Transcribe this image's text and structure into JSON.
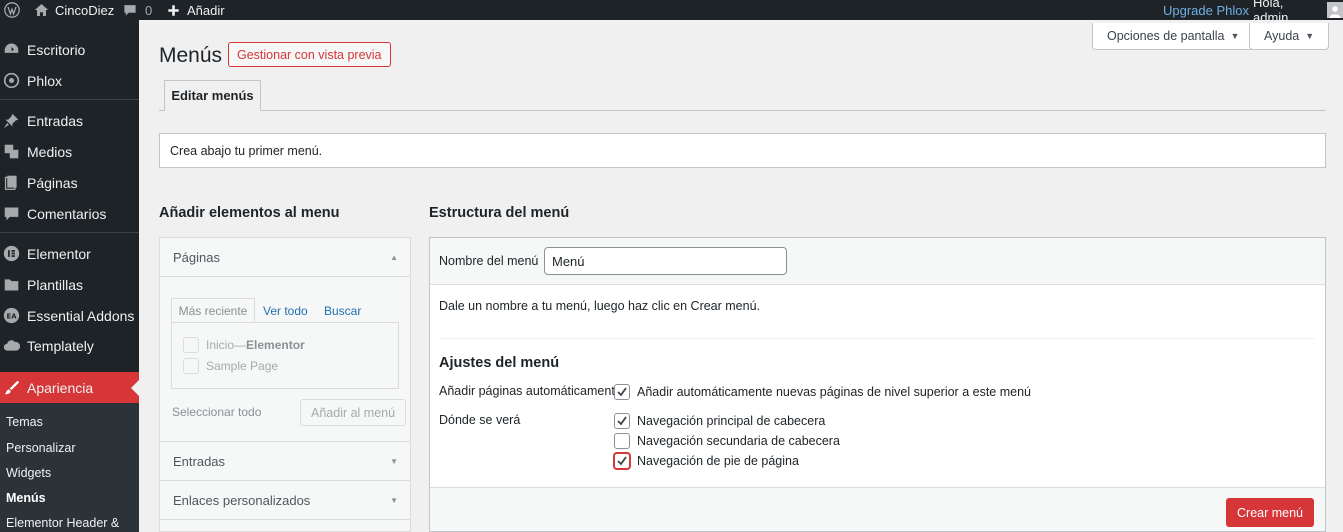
{
  "admin_bar": {
    "site_name": "CincoDiez",
    "comments_count": "0",
    "add_new": "Añadir",
    "upgrade": "Upgrade Phlox",
    "greeting": "Hola, admin"
  },
  "sidebar": {
    "items": [
      {
        "label": "Escritorio",
        "icon": "dashboard-icon"
      },
      {
        "label": "Phlox",
        "icon": "phlox-icon"
      },
      {
        "label": "Entradas",
        "icon": "pin-icon"
      },
      {
        "label": "Medios",
        "icon": "media-icon"
      },
      {
        "label": "Páginas",
        "icon": "pages-icon"
      },
      {
        "label": "Comentarios",
        "icon": "comment-icon"
      },
      {
        "label": "Elementor",
        "icon": "elementor-icon"
      },
      {
        "label": "Plantillas",
        "icon": "folder-icon"
      },
      {
        "label": "Essential Addons",
        "icon": "ea-icon"
      },
      {
        "label": "Templately",
        "icon": "cloud-icon"
      },
      {
        "label": "Apariencia",
        "icon": "brush-icon"
      }
    ],
    "submenu": [
      "Temas",
      "Personalizar",
      "Widgets",
      "Menús",
      "Elementor Header &"
    ]
  },
  "screen_options": "Opciones de pantalla",
  "help": "Ayuda",
  "page_title": "Menús",
  "manage_preview": "Gestionar con vista previa",
  "tab_edit": "Editar menús",
  "notice": "Crea abajo tu primer menú.",
  "left": {
    "title": "Añadir elementos al menu",
    "pages_head": "Páginas",
    "tabs": [
      "Más reciente",
      "Ver todo",
      "Buscar"
    ],
    "pages": [
      {
        "name": "Inicio",
        "sep": " — ",
        "suffix": "Elementor"
      },
      {
        "name": "Sample Page"
      }
    ],
    "select_all": "Seleccionar todo",
    "add_to_menu": "Añadir al menú",
    "posts_head": "Entradas",
    "custom_links_head": "Enlaces personalizados"
  },
  "right": {
    "title": "Estructura del menú",
    "menu_name_label": "Nombre del menú",
    "menu_name_value": "Menú",
    "instructions": "Dale un nombre a tu menú, luego haz clic en Crear menú.",
    "settings_title": "Ajustes del menú",
    "auto_add_label": "Añadir páginas automáticamente",
    "auto_add_option": "Añadir automáticamente nuevas páginas de nivel superior a este menú",
    "display_label": "Dónde se verá",
    "locations": [
      {
        "label": "Navegación principal de cabecera",
        "checked": true
      },
      {
        "label": "Navegación secundaria de cabecera",
        "checked": false
      },
      {
        "label": "Navegación de pie de página",
        "checked": true
      }
    ],
    "create_button": "Crear menú"
  },
  "colors": {
    "accent": "#d63638",
    "sidebar": "#1d2327",
    "link": "#2271b1"
  }
}
